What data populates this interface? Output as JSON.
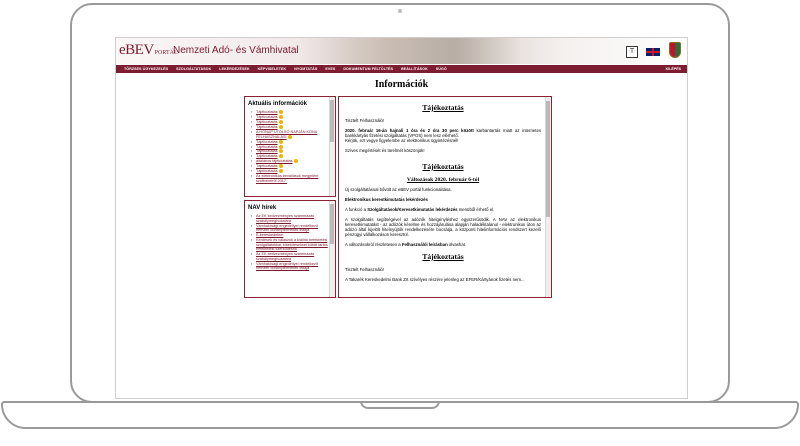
{
  "header": {
    "logo_main": "eBEV",
    "logo_sub": "PORTÁL",
    "site_title": "Nemzeti Adó- és Vámhivatal"
  },
  "icons": {
    "mobile": "mobile-icon",
    "mobile_label": "T",
    "flag": "uk-flag-icon",
    "crest": "hungarian-crest-icon"
  },
  "nav": {
    "items": [
      "TÖRZSES ÜGYKEZELÉS",
      "SZOLGÁLTATÁSOK",
      "LEKÉRDEZÉSEK",
      "KÉPVISELETEK",
      "NYOMTATÁS",
      "EVES",
      "DOKUMENTUM FELTÖLTÉS",
      "BEÁLLÍTÁSOK",
      "SÚGÓ"
    ],
    "logout": "KILÉPÉS"
  },
  "page": {
    "title": "Információk"
  },
  "current_info": {
    "title": "Aktuális információk",
    "items": [
      {
        "label": "Tájékoztatás",
        "new": true
      },
      {
        "label": "Tájékoztatás",
        "new": true
      },
      {
        "label": "Tájékoztatás",
        "new": true
      },
      {
        "label": "Tájékoztatás",
        "new": true
      },
      {
        "label": "A HÓNAP UTOLSÓ NAPJÁN KONA FELHASZNÁLÁSI",
        "new": true
      },
      {
        "label": "Tájékoztatás",
        "new": true
      },
      {
        "label": "Tájékoztatás",
        "new": true
      },
      {
        "label": "Tájékoztatás",
        "new": true
      },
      {
        "label": "Tájékoztatás",
        "new": true
      },
      {
        "label": "általános tájékoztatás",
        "new": true
      },
      {
        "label": "Tájékoztatás",
        "new": true
      },
      {
        "label": "Tájékoztatás",
        "new": true
      },
      {
        "label": "Az elektronikus bevallások megjelent szoftvereiről 2017.",
        "new": false
      }
    ]
  },
  "nav_news": {
    "title": "NAV hírek",
    "items": [
      {
        "label": "Az EK kedvezményes számmázás szabálymeghozatára"
      },
      {
        "label": "Vámhatósági engedéllyel rendelkező nemzeti dohánytermékek listája"
      },
      {
        "label": "E-kereskedelem"
      },
      {
        "label": "Kérdések és válaszok a kiállító befektetési szolgáltatókkal, kibékítésekkel kötött tartós befektetési szerződésről"
      },
      {
        "label": "Az EK kedvezményes számmázás szabálymeghozatára"
      },
      {
        "label": "Vámhatósági engedéllyel rendelkező nemzeti dohánytermékek listája"
      }
    ]
  },
  "content": {
    "h1": "Tájékoztatás",
    "greeting1": "Tisztelt Felhasználó!",
    "p1_bold": "2020. február 16-án hajnali 1 óra és 2 óra 30 perc között",
    "p1_rest": " karbantartás miatt az internetes bankkártyás fizetési szolgáltatás (VPOS) nem lesz elérhető.",
    "p1_line2": "Kérjük, ezt vegye figyelembe az elektronikus ügyintézésnél!",
    "p2": "Szíves megértését és türelmét köszönjük!",
    "h2": "Tájékoztatás",
    "sub2": "Változások 2020. február 6-tól",
    "p3": "Új szolgáltatással bővült az eBEV portál funkcionalitása.",
    "p4": "Elektronikus kerestkimutatás lekérdezés",
    "p5_a": "A funkció a ",
    "p5_b": "Szolgáltatások/Keresetkimutatás lekérdezés",
    "p5_c": " menüből érhető el.",
    "p6": "A szolgáltatás segítségével az adózók hitelgényléshez egyszerűsödik. A NAV az elektronikus keresetkimutatást - az adózók kérelme és hozzájárulása alapján haladéktalanul - elektronikus úton az adózó által kijelölt hitelnyújtók rendelkezésére bocsátja, a központi hitelinformációs rendszert kezelő pénzügyi vállalkozáson keresztül.",
    "p7_a": "A változásokról részletesen a ",
    "p7_b": "Felhasználói leírásban",
    "p7_c": " olvashat.",
    "h3": "Tájékoztatás",
    "greeting3": "Tisztelt Felhasználó!",
    "p8": "A Takarék Kereskedelmi Bank Zrt szívélyes részére jelenleg az EFER/Kártyánok fizetés nem..."
  }
}
